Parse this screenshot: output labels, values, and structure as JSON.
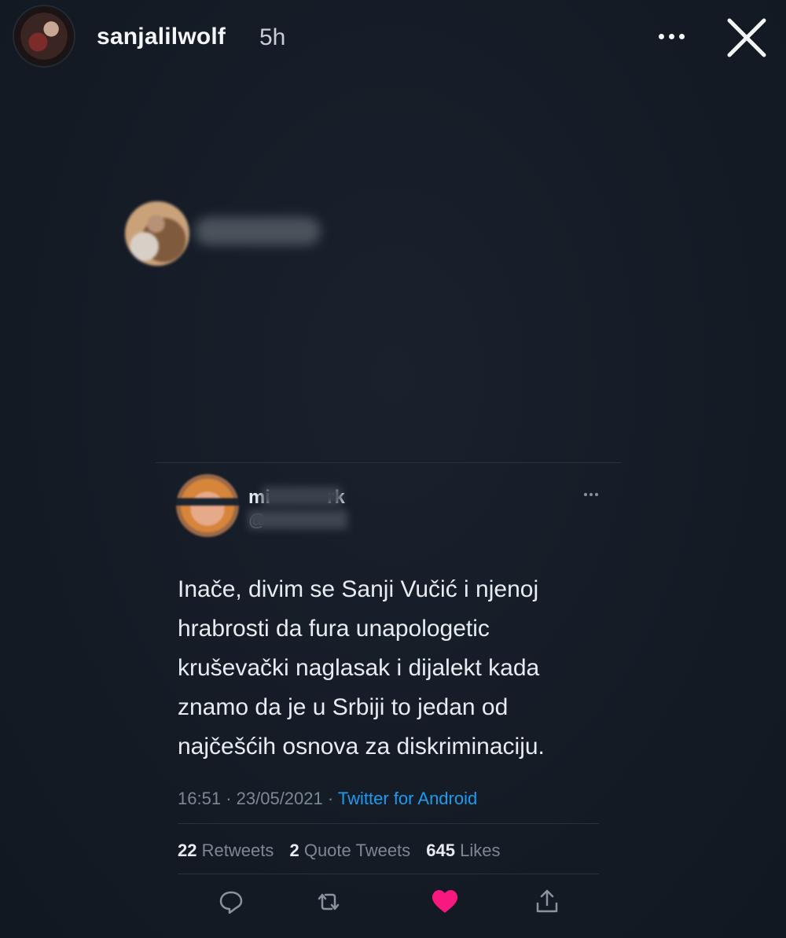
{
  "story": {
    "username": "sanjalilwolf",
    "time": "5h"
  },
  "tweet": {
    "name_visible": "mi",
    "name_tail": "rk",
    "handle_visible": "@",
    "text": "Inače, divim se Sanji Vučić i njenoj\nhrabrosti da fura unapologetic\nkruševački naglasak i dijalekt kada\nznamo da je u Srbiji to jedan od\nnajčešćih osnova za diskriminaciju.",
    "time": "16:51",
    "separator": "·",
    "date": "23/05/2021",
    "source": "Twitter for Android",
    "stats": {
      "retweets_count": "22",
      "retweets_label": "Retweets",
      "quotes_count": "2",
      "quotes_label": "Quote Tweets",
      "likes_count": "645",
      "likes_label": "Likes"
    }
  },
  "colors": {
    "background": "#141b25",
    "link": "#1d9bf0",
    "like": "#f91880",
    "muted": "#7e8893"
  },
  "icons": {
    "reply": "reply-icon",
    "retweet": "retweet-icon",
    "like": "heart-icon",
    "share": "share-icon",
    "close": "close-icon",
    "more": "more-icon"
  }
}
